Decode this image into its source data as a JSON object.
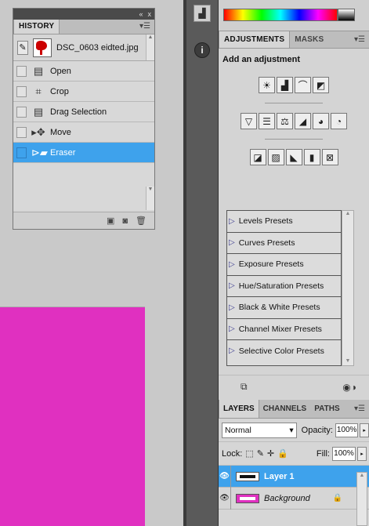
{
  "history": {
    "tab_label": "HISTORY",
    "snapshot_name": "DSC_0603 eidted.jpg",
    "steps": [
      {
        "label": "Open",
        "icon": "document-icon"
      },
      {
        "label": "Crop",
        "icon": "crop-icon"
      },
      {
        "label": "Drag Selection",
        "icon": "document-icon"
      },
      {
        "label": "Move",
        "icon": "move-tool-icon"
      },
      {
        "label": "Eraser",
        "icon": "eraser-icon"
      }
    ],
    "selected_step": "Eraser"
  },
  "adjustments": {
    "tab_adjustments": "ADJUSTMENTS",
    "tab_masks": "MASKS",
    "heading": "Add an adjustment",
    "presets": [
      "Levels Presets",
      "Curves Presets",
      "Exposure Presets",
      "Hue/Saturation Presets",
      "Black & White Presets",
      "Channel Mixer Presets",
      "Selective Color Presets"
    ]
  },
  "layers": {
    "tabs": [
      "LAYERS",
      "CHANNELS",
      "PATHS"
    ],
    "blend_mode": "Normal",
    "opacity_label": "Opacity:",
    "opacity_value": "100%",
    "lock_label": "Lock:",
    "fill_label": "Fill:",
    "fill_value": "100%",
    "items": [
      {
        "name": "Layer 1",
        "selected": true
      },
      {
        "name": "Background",
        "selected": false
      }
    ]
  },
  "colors": {
    "selection": "#3ea2ec",
    "canvas": "#e030c0"
  }
}
